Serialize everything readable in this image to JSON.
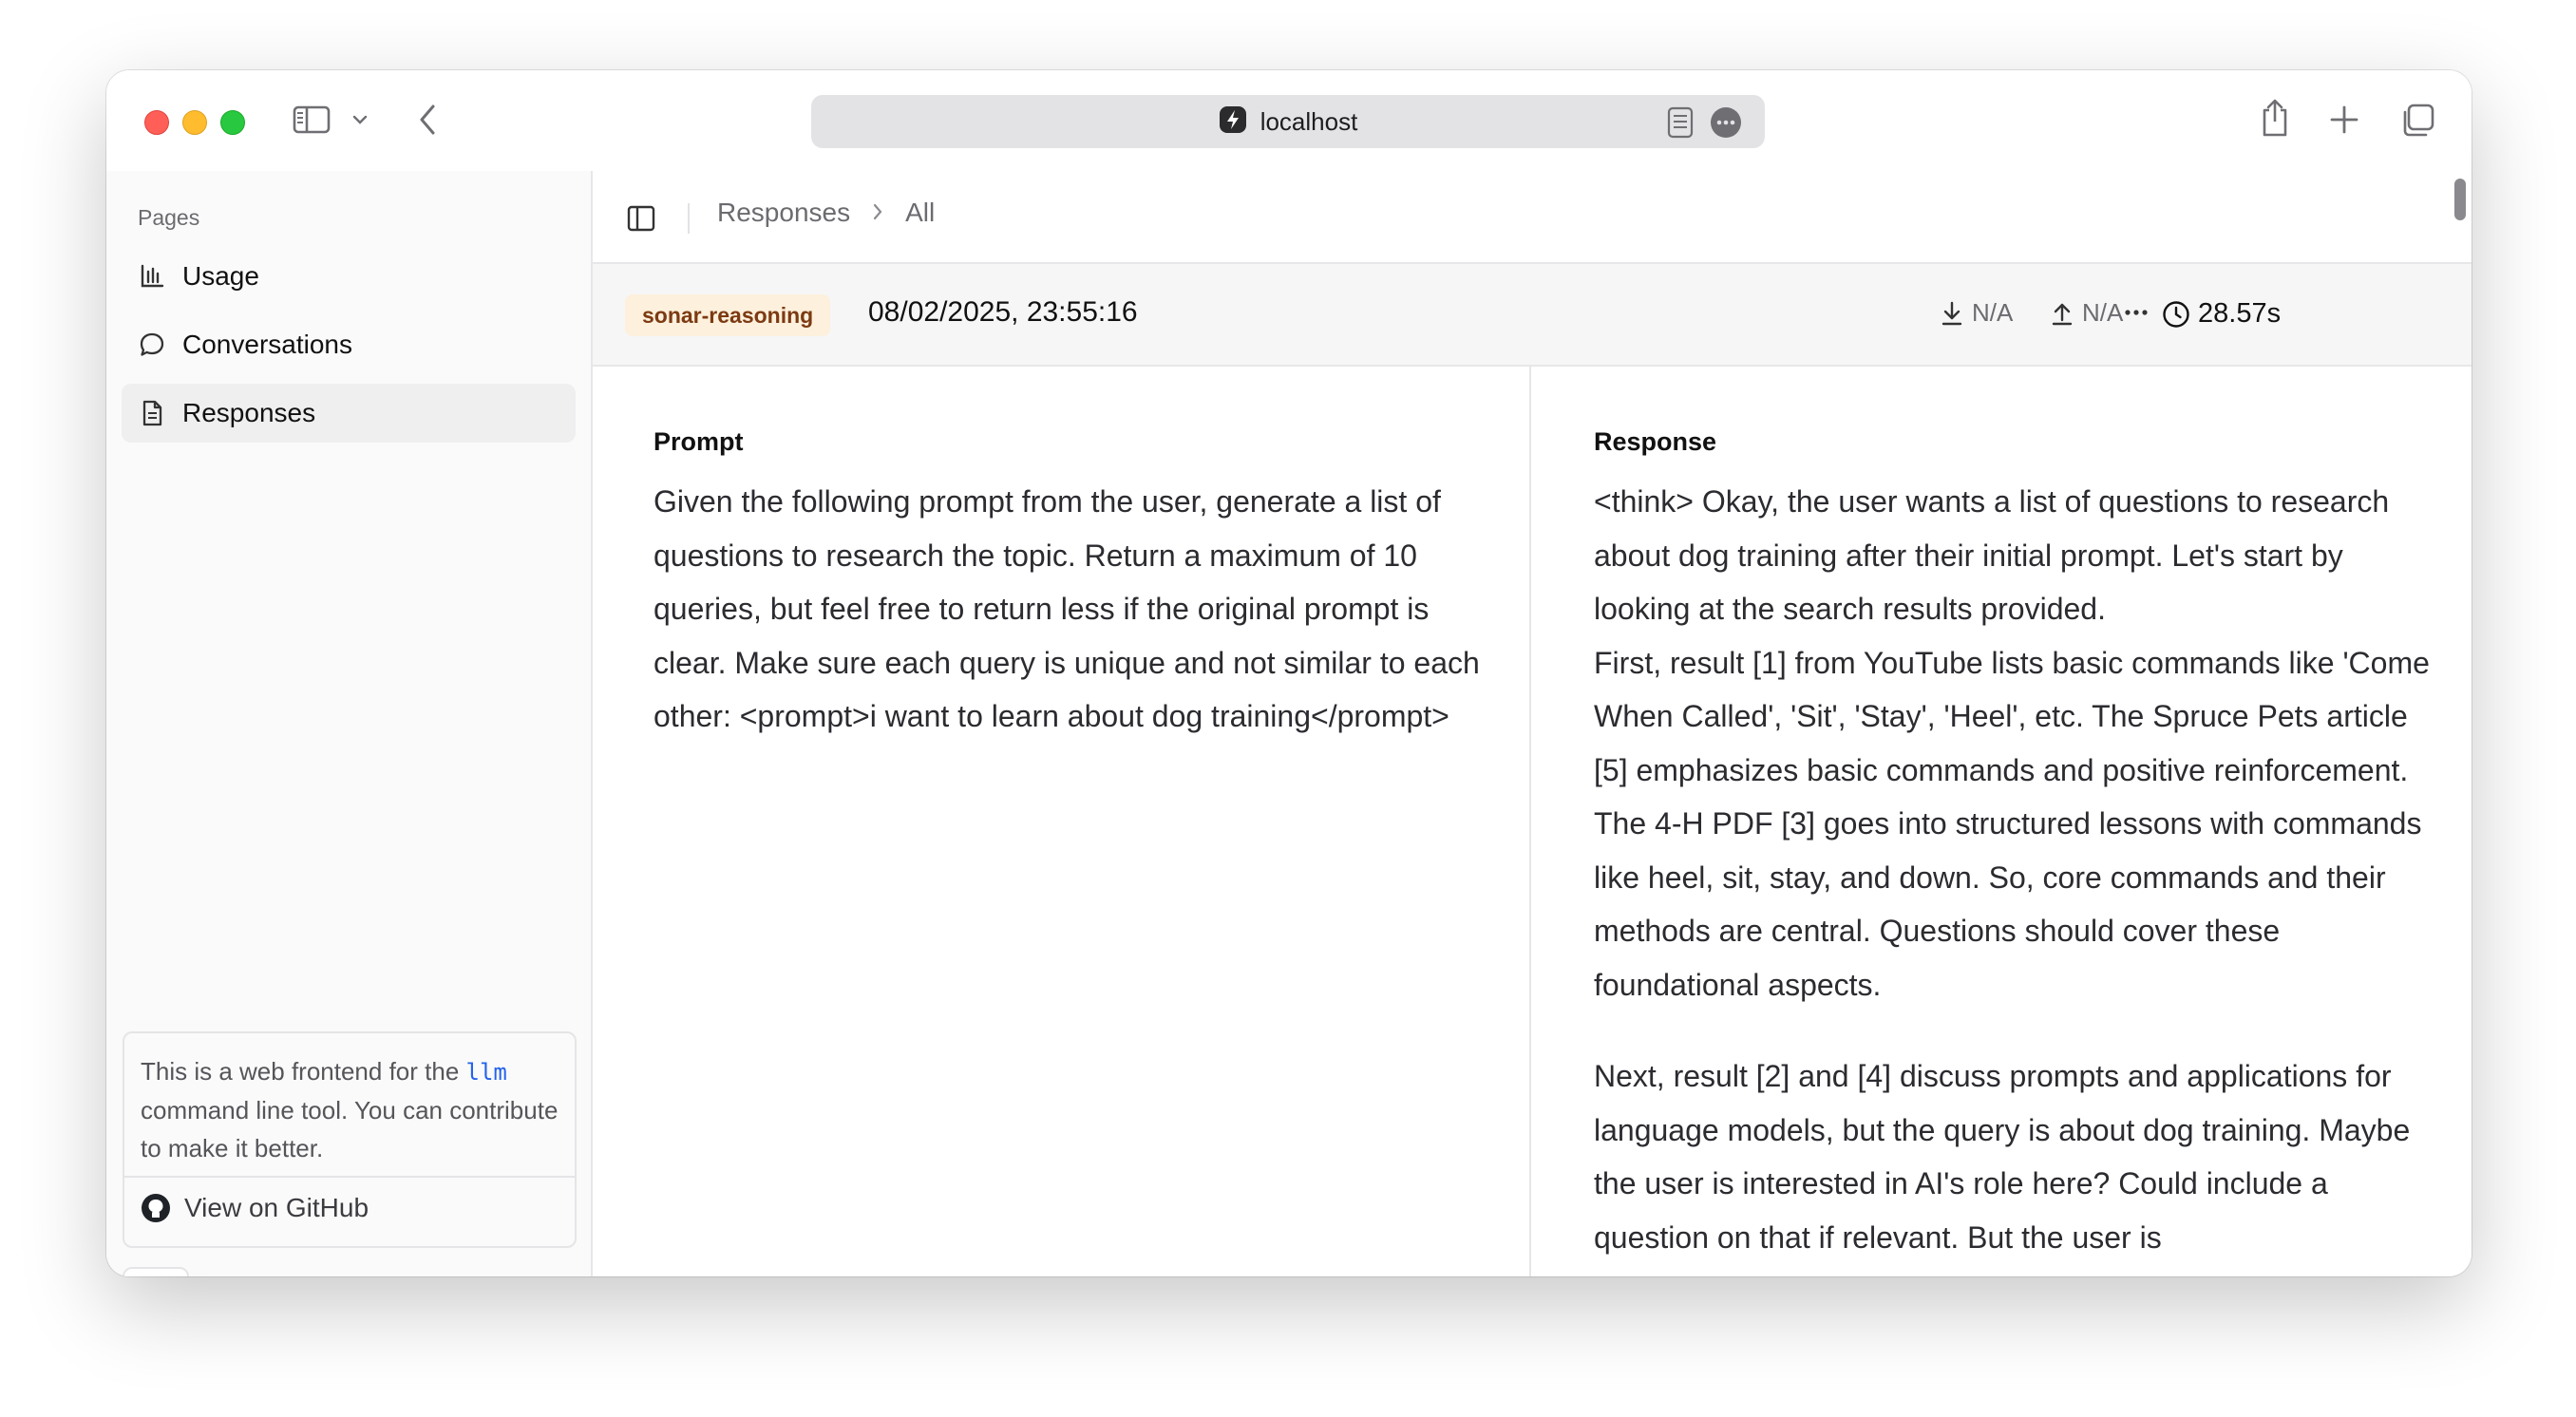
{
  "browser": {
    "url": "localhost",
    "icons": [
      "sidebar-icon",
      "chevron-down-icon",
      "back-icon",
      "reader-icon",
      "more-icon",
      "share-icon",
      "plus-icon",
      "tabs-icon"
    ]
  },
  "sidebar": {
    "section_label": "Pages",
    "items": [
      {
        "label": "Usage",
        "icon": "bar-chart-icon"
      },
      {
        "label": "Conversations",
        "icon": "chat-bubble-icon"
      },
      {
        "label": "Responses",
        "icon": "document-icon",
        "active": true
      }
    ],
    "info": {
      "text_before": "This is a web frontend for the",
      "code": "llm",
      "text_after": "command line tool. You can contribute to make it better."
    },
    "github_label": "View on GitHub",
    "theme_icon": "sun-icon"
  },
  "breadcrumb": {
    "items": [
      "Responses",
      "All"
    ]
  },
  "meta": {
    "model": "sonar-reasoning",
    "timestamp": "08/02/2025, 23:55:16",
    "input_tokens": "N/A",
    "output_tokens": "N/A",
    "duration": "28.57s"
  },
  "prompt": {
    "title": "Prompt",
    "text": "Given the following prompt from the user, generate a list of questions to research the topic. Return a maximum of 10 queries, but feel free to return less if the original prompt is clear. Make sure each query is unique and not similar to each other: <prompt>i want to learn about dog training</prompt>"
  },
  "response": {
    "title": "Response",
    "paragraph_1": "<think> Okay, the user wants a list of questions to research about dog training after their initial prompt. Let's start by looking at the search results provided.",
    "paragraph_2": "First, result [1] from YouTube lists basic commands like 'Come When Called', 'Sit', 'Stay', 'Heel', etc. The Spruce Pets article [5] emphasizes basic commands and positive reinforcement. The 4-H PDF [3] goes into structured lessons with commands like heel, sit, stay, and down. So, core commands and their methods are central. Questions should cover these foundational aspects.",
    "paragraph_3": "Next, result [2] and [4] discuss prompts and applications for language models, but the query is about dog training. Maybe the user is interested in AI's role here? Could include a question on that if relevant. But the user is"
  }
}
